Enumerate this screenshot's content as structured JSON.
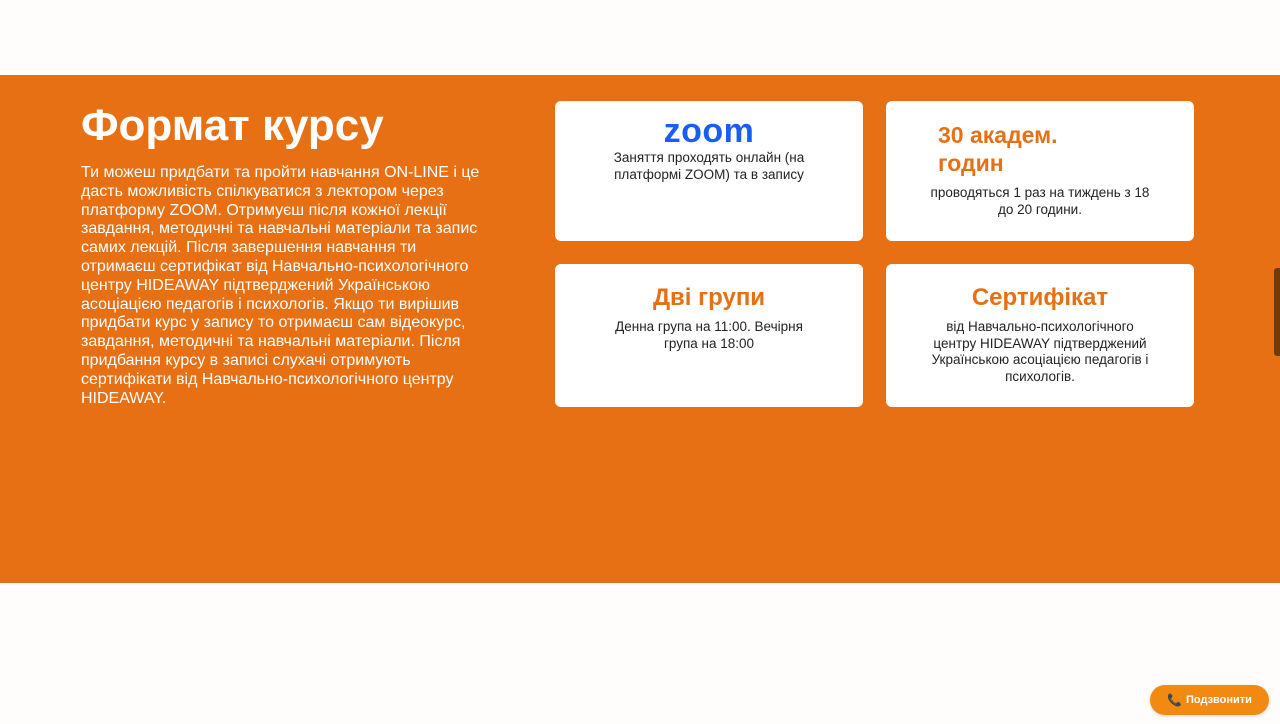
{
  "format": {
    "title": "Формат курсу",
    "description": "Ти можеш придбати та пройти навчання ON-LINE і це дасть можливість спілкуватися з лектором через платформу ZOOM. Отримуєш після кожної лекції завдання, методичні та навчальні матеріали та запис самих лекцій. Після завершення навчання ти отримаєш сертифікат від Навчально-психологічного центру HIDEAWAY підтверджений Українською асоціацією педагогів і психологів. Якщо ти вирішив придбати курс у запису то отримаєш сам відеокурс, завдання, методичні та навчальні матеріали. Після придбання курсу в записі слухачі отримують сертифікати від Навчально-психологічного центру HIDEAWAY."
  },
  "cards": {
    "zoom": {
      "logo_text": "zoom",
      "text": "Заняття проходять онлайн (на платформі ZOOM) та в запису"
    },
    "hours": {
      "title": "30 академ. годин",
      "text": "проводяться 1 раз на тиждень з 18 до 20 години."
    },
    "groups": {
      "title": "Дві групи",
      "text": "Денна група на 11:00. Вечірня група на 18:00"
    },
    "certificate": {
      "title": "Сертифікат",
      "text": "від Навчально-психологічного центру HIDEAWAY підтверджений Українською асоціацією педагогів і психологів."
    }
  },
  "call_button": {
    "icon": "phone-icon",
    "label": "Подзвонити"
  },
  "colors": {
    "accent": "#e77015",
    "zoom_blue": "#1a5df5",
    "button": "#f28a12"
  }
}
